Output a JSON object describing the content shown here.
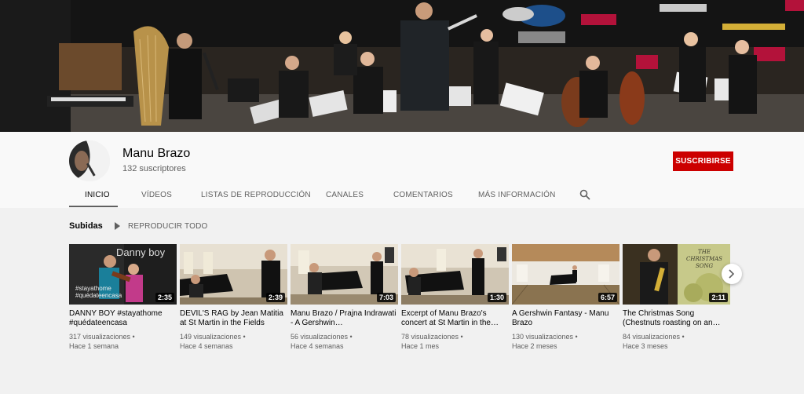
{
  "channel": {
    "name": "Manu Brazo",
    "subscribers": "132 suscriptores",
    "subscribe_label": "SUSCRIBIRSE"
  },
  "tabs": [
    {
      "label": "INICIO",
      "active": true
    },
    {
      "label": "VÍDEOS"
    },
    {
      "label": "LISTAS DE REPRODUCCIÓN"
    },
    {
      "label": "CANALES"
    },
    {
      "label": "COMENTARIOS"
    },
    {
      "label": "MÁS INFORMACIÓN"
    }
  ],
  "section": {
    "title": "Subidas",
    "play_all": "REPRODUCIR TODO"
  },
  "videos": [
    {
      "title": "DANNY BOY #stayathome #quédateencasa",
      "duration": "2:35",
      "views": "317 visualizaciones",
      "age": "Hace 1 semana",
      "thumb_text": "Danny boy",
      "thumb_tags": "#stayathome\n#quédateencasa"
    },
    {
      "title": "DEVIL'S RAG by Jean Matitia at St Martin in the Fields",
      "duration": "2:39",
      "views": "149 visualizaciones",
      "age": "Hace 4 semanas"
    },
    {
      "title": "Manu Brazo / Prajna Indrawati - A Gershwin…",
      "duration": "7:03",
      "views": "56 visualizaciones",
      "age": "Hace 4 semanas"
    },
    {
      "title": "Excerpt of Manu Brazo's concert at St Martin in the…",
      "duration": "1:30",
      "views": "78 visualizaciones",
      "age": "Hace 1 mes"
    },
    {
      "title": "A Gershwin Fantasy - Manu Brazo",
      "duration": "6:57",
      "views": "130 visualizaciones",
      "age": "Hace 2 meses"
    },
    {
      "title": "The Christmas Song (Chestnuts roasting on an…",
      "duration": "2:11",
      "views": "84 visualizaciones",
      "age": "Hace 3 meses",
      "thumb_text": "THE CHRISTMAS SONG"
    }
  ],
  "icons": {
    "search": "search-icon",
    "next": "chevron-right-icon",
    "play": "play-icon"
  },
  "colors": {
    "subscribe": "#cc0000",
    "background": "#f1f1f1",
    "header": "#f9f9f9"
  }
}
